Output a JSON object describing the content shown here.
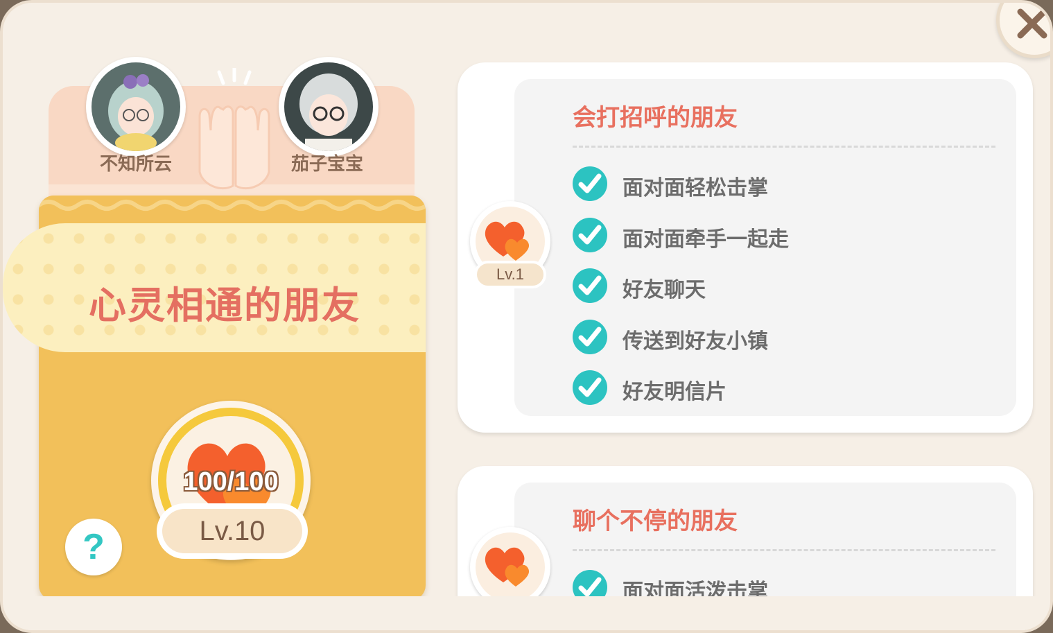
{
  "window": {
    "close_icon": "close-icon"
  },
  "friendship": {
    "left_user": {
      "name": "不知所云"
    },
    "right_user": {
      "name": "茄子宝宝"
    },
    "relation_title": "心灵相通的朋友",
    "heart_points": "100/100",
    "level": "Lv.10",
    "help_label": "?"
  },
  "tiers": [
    {
      "level": "Lv.1",
      "title": "会打招呼的朋友",
      "perks": [
        "面对面轻松击掌",
        "面对面牵手一起走",
        "好友聊天",
        "传送到好友小镇",
        "好友明信片"
      ]
    },
    {
      "title": "聊个不停的朋友",
      "perks": [
        "面对面活泼击掌"
      ]
    }
  ],
  "colors": {
    "accent_teal": "#2cc3c1",
    "title_red": "#e8705f",
    "gold": "#f2c05a"
  }
}
